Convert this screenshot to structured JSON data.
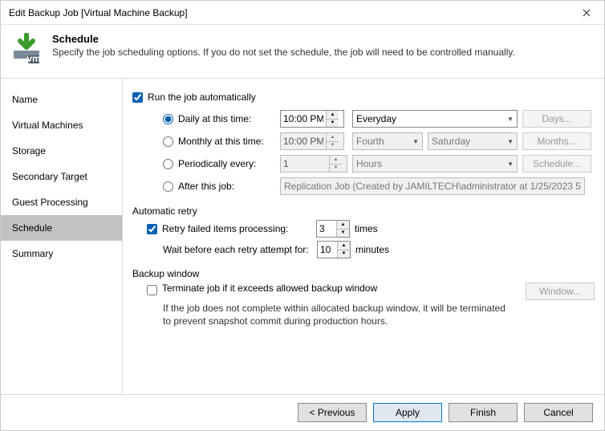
{
  "window": {
    "title": "Edit Backup Job [Virtual Machine Backup]"
  },
  "header": {
    "title": "Schedule",
    "description": "Specify the job scheduling options. If you do not set the schedule, the job will need to be controlled manually."
  },
  "sidebar": {
    "items": [
      {
        "label": "Name"
      },
      {
        "label": "Virtual Machines"
      },
      {
        "label": "Storage"
      },
      {
        "label": "Secondary Target"
      },
      {
        "label": "Guest Processing"
      },
      {
        "label": "Schedule"
      },
      {
        "label": "Summary"
      }
    ]
  },
  "schedule": {
    "run_auto_label": "Run the job automatically",
    "daily_label": "Daily at this time:",
    "daily_time": "10:00 PM",
    "daily_scope": "Everyday",
    "days_btn": "Days...",
    "monthly_label": "Monthly at this time:",
    "monthly_time": "10:00 PM",
    "monthly_ordinal": "Fourth",
    "monthly_day": "Saturday",
    "months_btn": "Months...",
    "periodic_label": "Periodically every:",
    "periodic_value": "1",
    "periodic_unit": "Hours",
    "schedule_btn": "Schedule...",
    "after_label": "After this job:",
    "after_value": "Replication Job (Created by JAMILTECH\\administrator at 1/25/2023 5:"
  },
  "retry": {
    "section": "Automatic retry",
    "retry_label": "Retry failed items processing:",
    "retry_count": "3",
    "times": "times",
    "wait_label": "Wait before each retry attempt for:",
    "wait_value": "10",
    "minutes": "minutes"
  },
  "window_section": {
    "section": "Backup window",
    "terminate_label": "Terminate job if it exceeds allowed backup window",
    "window_btn": "Window...",
    "desc": "If the job does not complete within allocated backup window, it will be terminated to prevent snapshot commit during production hours."
  },
  "footer": {
    "previous": "< Previous",
    "apply": "Apply",
    "finish": "Finish",
    "cancel": "Cancel"
  }
}
